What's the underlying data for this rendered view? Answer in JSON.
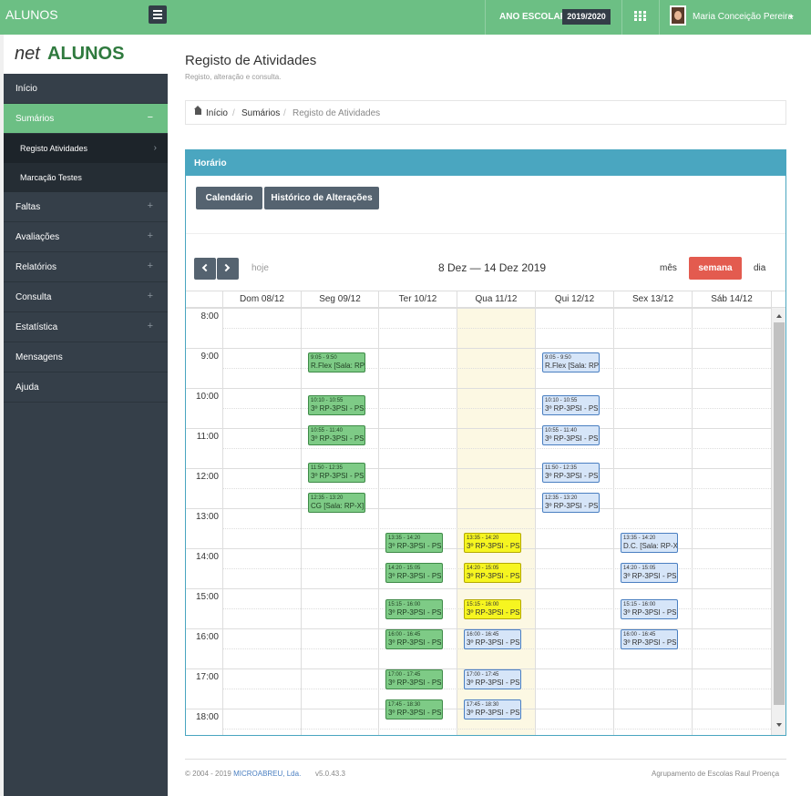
{
  "app": {
    "brand": "ALUNOS",
    "school_year_label": "ANO ESCOLAR",
    "school_year": "2019/2020",
    "user_name": "Maria Conceição Pereira",
    "logo_prefix": "net",
    "logo_main": "ALUNOS"
  },
  "sidebar": {
    "items": [
      {
        "label": "Início",
        "has_plus": false
      },
      {
        "label": "Sumários",
        "toggle": "−"
      },
      {
        "label": "Registo Atividades"
      },
      {
        "label": "Marcação Testes"
      },
      {
        "label": "Faltas",
        "toggle": "+"
      },
      {
        "label": "Avaliações",
        "toggle": "+"
      },
      {
        "label": "Relatórios",
        "toggle": "+"
      },
      {
        "label": "Consulta",
        "toggle": "+"
      },
      {
        "label": "Estatística",
        "toggle": "+"
      },
      {
        "label": "Mensagens"
      },
      {
        "label": "Ajuda"
      }
    ]
  },
  "page": {
    "title": "Registo de Atividades",
    "subtitle": "Registo, alteração e consulta."
  },
  "breadcrumb": {
    "home": "Início",
    "sumarios": "Sumários",
    "current": "Registo de Atividades",
    "sep": "/"
  },
  "panel": {
    "title": "Horário",
    "tab_calendar": "Calendário",
    "tab_history": "Histórico de Alterações"
  },
  "calendar": {
    "today_label": "hoje",
    "range": "8 Dez — 14 Dez 2019",
    "view_month": "mês",
    "view_week": "semana",
    "view_day": "dia",
    "days": [
      "Dom 08/12",
      "Seg 09/12",
      "Ter 10/12",
      "Qua 11/12",
      "Qui 12/12",
      "Sex 13/12",
      "Sáb 14/12"
    ],
    "hours": [
      "8:00",
      "9:00",
      "10:00",
      "11:00",
      "12:00",
      "13:00",
      "14:00",
      "15:00",
      "16:00",
      "17:00",
      "18:00"
    ],
    "events": [
      {
        "day": 1,
        "start": "9:05",
        "end": "9:50",
        "time": "9:05 - 9:50",
        "name": "R.Flex [Sala: RP-",
        "color": "green"
      },
      {
        "day": 1,
        "start": "10:10",
        "end": "10:55",
        "time": "10:10 - 10:55",
        "name": "3º RP-3PSI - PSI",
        "color": "green"
      },
      {
        "day": 1,
        "start": "10:55",
        "end": "11:40",
        "time": "10:55 - 11:40",
        "name": "3º RP-3PSI - PSI",
        "color": "green"
      },
      {
        "day": 1,
        "start": "11:50",
        "end": "12:35",
        "time": "11:50 - 12:35",
        "name": "3º RP-3PSI - PSI",
        "color": "green"
      },
      {
        "day": 1,
        "start": "12:35",
        "end": "13:20",
        "time": "12:35 - 13:20",
        "name": "CG [Sala: RP-X]",
        "color": "green"
      },
      {
        "day": 2,
        "start": "13:35",
        "end": "14:20",
        "time": "13:35 - 14:20",
        "name": "3º RP-3PSI - PSI",
        "color": "green"
      },
      {
        "day": 2,
        "start": "14:20",
        "end": "15:05",
        "time": "14:20 - 15:05",
        "name": "3º RP-3PSI - PSI",
        "color": "green"
      },
      {
        "day": 2,
        "start": "15:15",
        "end": "16:00",
        "time": "15:15 - 16:00",
        "name": "3º RP-3PSI - PSI",
        "color": "green"
      },
      {
        "day": 2,
        "start": "16:00",
        "end": "16:45",
        "time": "16:00 - 16:45",
        "name": "3º RP-3PSI - PSI",
        "color": "green"
      },
      {
        "day": 2,
        "start": "17:00",
        "end": "17:45",
        "time": "17:00 - 17:45",
        "name": "3º RP-3PSI - PSI",
        "color": "green"
      },
      {
        "day": 2,
        "start": "17:45",
        "end": "18:30",
        "time": "17:45 - 18:30",
        "name": "3º RP-3PSI - PSI",
        "color": "green"
      },
      {
        "day": 3,
        "start": "13:35",
        "end": "14:20",
        "time": "13:35 - 14:20",
        "name": "3º RP-3PSI - PSI",
        "color": "yellow"
      },
      {
        "day": 3,
        "start": "14:20",
        "end": "15:05",
        "time": "14:20 - 15:05",
        "name": "3º RP-3PSI - PSI",
        "color": "yellow"
      },
      {
        "day": 3,
        "start": "15:15",
        "end": "16:00",
        "time": "15:15 - 16:00",
        "name": "3º RP-3PSI - PSI",
        "color": "yellow"
      },
      {
        "day": 3,
        "start": "16:00",
        "end": "16:45",
        "time": "16:00 - 16:45",
        "name": "3º RP-3PSI - PSI",
        "color": "blue"
      },
      {
        "day": 3,
        "start": "17:00",
        "end": "17:45",
        "time": "17:00 - 17:45",
        "name": "3º RP-3PSI - PSI",
        "color": "blue"
      },
      {
        "day": 3,
        "start": "17:45",
        "end": "18:30",
        "time": "17:45 - 18:30",
        "name": "3º RP-3PSI - PSI",
        "color": "blue"
      },
      {
        "day": 4,
        "start": "9:05",
        "end": "9:50",
        "time": "9:05 - 9:50",
        "name": "R.Flex [Sala: RP-",
        "color": "blue"
      },
      {
        "day": 4,
        "start": "10:10",
        "end": "10:55",
        "time": "10:10 - 10:55",
        "name": "3º RP-3PSI - PSI",
        "color": "blue"
      },
      {
        "day": 4,
        "start": "10:55",
        "end": "11:40",
        "time": "10:55 - 11:40",
        "name": "3º RP-3PSI - PSI",
        "color": "blue"
      },
      {
        "day": 4,
        "start": "11:50",
        "end": "12:35",
        "time": "11:50 - 12:35",
        "name": "3º RP-3PSI - PSI",
        "color": "blue"
      },
      {
        "day": 4,
        "start": "12:35",
        "end": "13:20",
        "time": "12:35 - 13:20",
        "name": "3º RP-3PSI - PSI",
        "color": "blue"
      },
      {
        "day": 5,
        "start": "13:35",
        "end": "14:20",
        "time": "13:35 - 14:20",
        "name": "D.C. [Sala: RP-X]",
        "color": "blue"
      },
      {
        "day": 5,
        "start": "14:20",
        "end": "15:05",
        "time": "14:20 - 15:05",
        "name": "3º RP-3PSI - PSI",
        "color": "blue"
      },
      {
        "day": 5,
        "start": "15:15",
        "end": "16:00",
        "time": "15:15 - 16:00",
        "name": "3º RP-3PSI - PSI",
        "color": "blue"
      },
      {
        "day": 5,
        "start": "16:00",
        "end": "16:45",
        "time": "16:00 - 16:45",
        "name": "3º RP-3PSI - PSI",
        "color": "blue"
      }
    ]
  },
  "footer": {
    "copyright": "© 2004 - 2019",
    "company": "MICROABREU, Lda.",
    "version": "v5.0.43.3",
    "school": "Agrupamento de Escolas Raul Proença"
  },
  "colors": {
    "topbar": "#6cbf84",
    "sidebar": "#353f49",
    "panel_accent": "#4aa6c0",
    "week_active": "#e35b4f",
    "event_green": "#7ecb86",
    "event_blue": "#d6e5f8",
    "event_yellow": "#f6f520"
  }
}
